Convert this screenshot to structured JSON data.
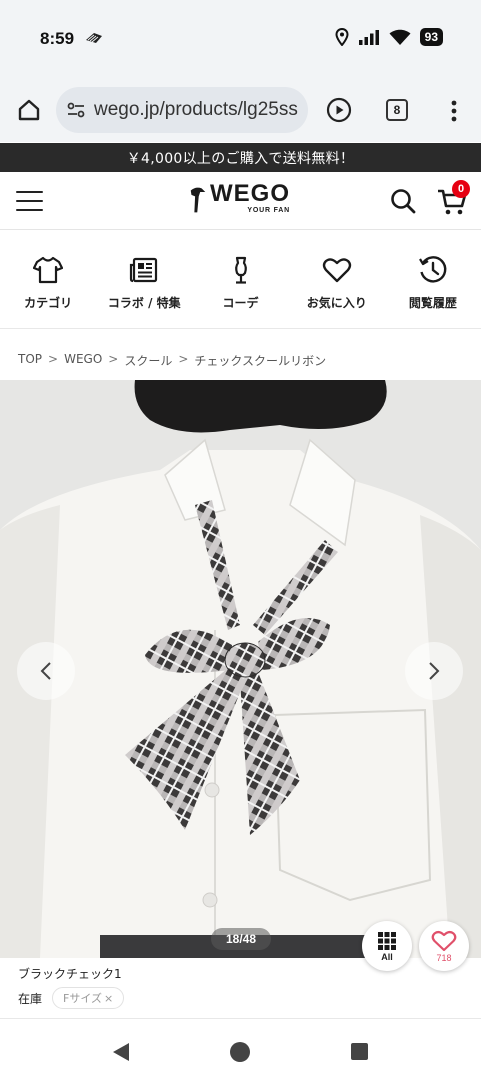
{
  "status_bar": {
    "time": "8:59",
    "battery": "93",
    "icons": [
      "notification-icon",
      "location-icon",
      "signal-icon",
      "wifi-icon",
      "battery-icon"
    ]
  },
  "browser": {
    "url": "wego.jp/products/lg25ss",
    "tab_count": "8",
    "icons": [
      "home-icon",
      "site-settings-icon",
      "play-icon",
      "tabs-icon",
      "more-menu-icon"
    ]
  },
  "promo": {
    "text": "￥4,000以上のご購入で送料無料！"
  },
  "header": {
    "logo_main": "WEGO",
    "logo_sub": "YOUR FAN",
    "cart_count": "0",
    "icons": [
      "hamburger-icon",
      "search-icon",
      "cart-icon"
    ]
  },
  "quick_nav": [
    {
      "label": "カテゴリ",
      "icon": "tshirt-icon"
    },
    {
      "label": "コラボ / 特集",
      "icon": "newspaper-icon"
    },
    {
      "label": "コーデ",
      "icon": "mannequin-icon"
    },
    {
      "label": "お気に入り",
      "icon": "heart-icon"
    },
    {
      "label": "閲覧履歴",
      "icon": "history-icon"
    }
  ],
  "breadcrumb": {
    "items": [
      "TOP",
      "WEGO",
      "スクール",
      "チェックスクールリボン"
    ],
    "separator": ">"
  },
  "gallery": {
    "counter": "18/48",
    "all_label": "All",
    "favorite_count": "718"
  },
  "product": {
    "color_name": "ブラックチェック1",
    "stock_label": "在庫",
    "size_chip": "Fサイズ",
    "size_chip_close": "×"
  },
  "colors": {
    "promo_bg": "#2a2a2a",
    "cart_badge": "#e60012",
    "favorite_pink": "#e0506a",
    "browser_bg": "#f2f4f6"
  }
}
